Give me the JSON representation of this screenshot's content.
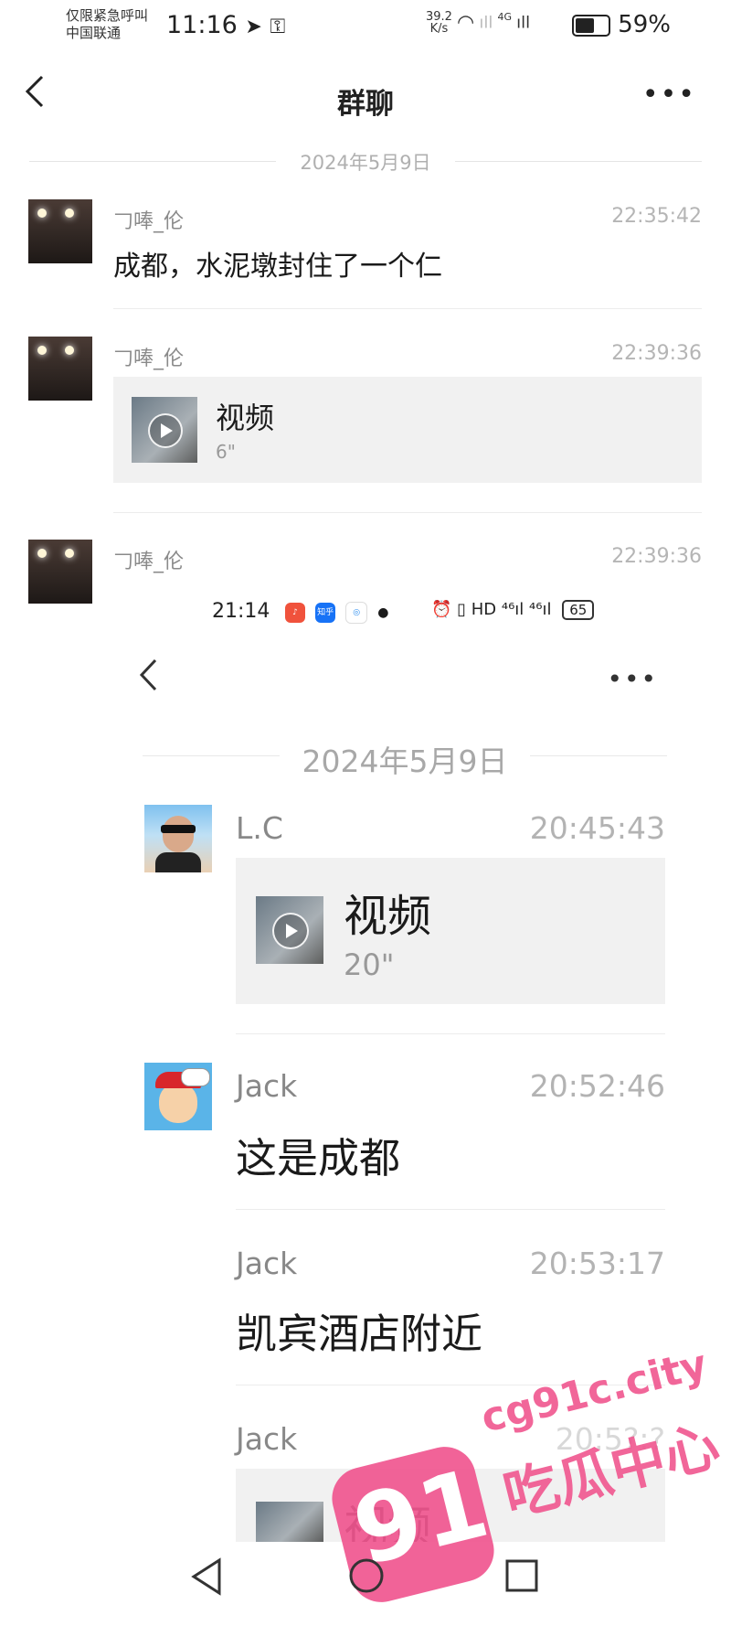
{
  "status_bar": {
    "carrier_line1": "仅限紧急呼叫",
    "carrier_line2": "中国联通",
    "time": "11:16",
    "speed_value": "39.2",
    "speed_unit": "K/s",
    "network": "4G",
    "battery": "59%"
  },
  "nav": {
    "back_icon": "chevron-left-icon",
    "title": "群聊",
    "more_icon": "more-dots-icon",
    "more_glyph": "•••"
  },
  "date_divider": "2024年5月9日",
  "messages": [
    {
      "sender": "𠃌唪_伦",
      "time": "22:35:42",
      "text": "成都，水泥墩封住了一个仁"
    },
    {
      "sender": "𠃌唪_伦",
      "time": "22:39:36",
      "video_label": "视频",
      "video_duration": "6\""
    },
    {
      "sender": "𠃌唪_伦",
      "time": "22:39:36"
    }
  ],
  "inner_screenshot": {
    "status_time": "21:14",
    "app_icons": [
      "music-app-icon",
      "zhihu-app-icon",
      "browser-app-icon"
    ],
    "zhihu_text": "知乎",
    "status_right": "⏰ ▯ HD  ⁴⁶ıl ⁴⁶ıl",
    "battery": "65",
    "more_glyph": "•••",
    "date_divider": "2024年5月9日",
    "messages": [
      {
        "sender": "L.C",
        "time": "20:45:43",
        "video_label": "视频",
        "video_duration": "20\""
      },
      {
        "sender": "Jack",
        "time": "20:52:46",
        "text": "这是成都"
      },
      {
        "sender": "Jack",
        "time": "20:53:17",
        "text": "凯宾酒店附近"
      },
      {
        "sender": "Jack",
        "time": "20:5?:?",
        "video_label": "视频"
      }
    ]
  },
  "watermark": {
    "badge": "91",
    "domain": "cg91c.city",
    "name": "吃瓜中心"
  },
  "bottom_nav": [
    "back-triangle-icon",
    "home-circle-icon",
    "recents-square-icon"
  ]
}
